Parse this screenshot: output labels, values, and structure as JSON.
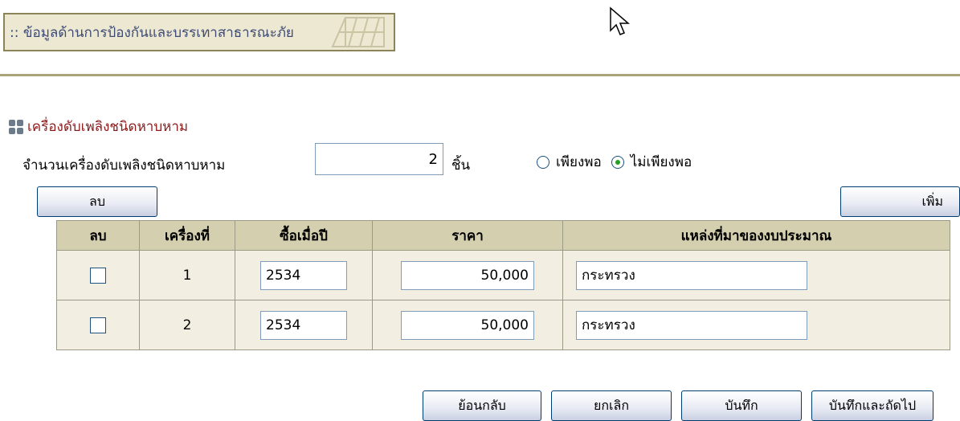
{
  "header": {
    "title": ":: ข้อมูลด้านการป้องกันและบรรเทาสาธารณะภัย"
  },
  "section": {
    "title": "เครื่องดับเพลิงชนิดหาบหาม"
  },
  "count": {
    "label": "จำนวนเครื่องดับเพลิงชนิดหาบหาม",
    "value": "2",
    "unit": "ชิ้น"
  },
  "sufficiency": {
    "options": [
      {
        "label": "เพียงพอ",
        "selected": false
      },
      {
        "label": "ไม่เพียงพอ",
        "selected": true
      }
    ]
  },
  "buttons": {
    "delete": "ลบ",
    "add": "เพิ่ม",
    "back": "ย้อนกลับ",
    "cancel": "ยกเลิก",
    "save": "บันทึก",
    "save_next": "บันทึกและถัดไป"
  },
  "table": {
    "headers": [
      "ลบ",
      "เครื่องที่",
      "ซื้อเมื่อปี",
      "ราคา",
      "แหล่งที่มาของงบประมาณ"
    ],
    "rows": [
      {
        "checked": false,
        "no": "1",
        "year": "2534",
        "price": "50,000",
        "source": "กระทรวง"
      },
      {
        "checked": false,
        "no": "2",
        "year": "2534",
        "price": "50,000",
        "source": "กระทรวง"
      }
    ]
  }
}
